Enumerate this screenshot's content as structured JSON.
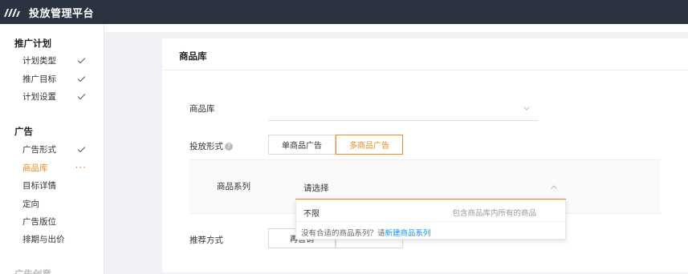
{
  "app": {
    "title": "投放管理平台"
  },
  "sidebar": {
    "groups": [
      {
        "title": "推广计划",
        "items": [
          {
            "label": "计划类型"
          },
          {
            "label": "推广目标"
          },
          {
            "label": "计划设置"
          }
        ]
      },
      {
        "title": "广告",
        "items": [
          {
            "label": "广告形式"
          },
          {
            "label": "商品库"
          },
          {
            "label": "目标详情"
          },
          {
            "label": "定向"
          },
          {
            "label": "广告版位"
          },
          {
            "label": "排期与出价"
          }
        ]
      },
      {
        "title": "广告创意"
      }
    ],
    "active_item": "商品库"
  },
  "card": {
    "title": "商品库"
  },
  "form": {
    "product_library": {
      "label": "商品库",
      "value": ""
    },
    "ad_format": {
      "label": "投放形式",
      "options": [
        "单商品广告",
        "多商品广告"
      ],
      "selected": "多商品广告"
    },
    "product_series": {
      "label": "商品系列",
      "placeholder": "请选择",
      "dropdown": {
        "options": [
          {
            "label": "不限",
            "description": "包含商品库内所有的商品"
          }
        ],
        "footer_text": "没有合适的商品系列？请",
        "footer_link": "新建商品系列"
      }
    },
    "recommend_method": {
      "label": "推荐方式",
      "options": [
        "再营销",
        ""
      ]
    }
  },
  "colors": {
    "accent": "#ef8a26",
    "topbar": "#2b3240",
    "link": "#1890ff"
  }
}
